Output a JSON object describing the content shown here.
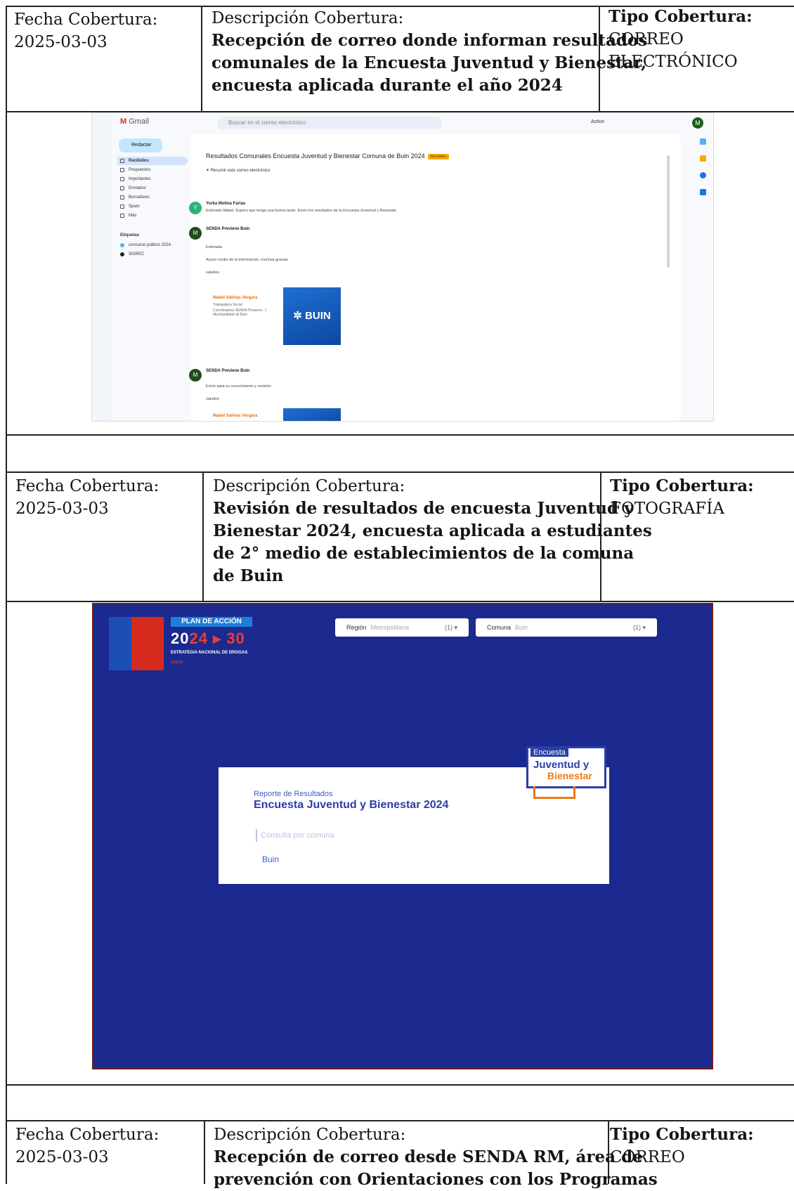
{
  "rows": [
    {
      "fecha_label": "Fecha Cobertura:",
      "fecha_value": "2025-03-03",
      "desc_label": "Descripción Cobertura:",
      "desc_lines": [
        "Recepción de correo donde informan resultados",
        "comunales de la Encuesta Juventud y Bienestar,",
        "encuesta aplicada durante el año 2024"
      ],
      "tipo_label": "Tipo Cobertura:",
      "tipo_lines": [
        "CORREO",
        "ELECTRÓNICO"
      ]
    },
    {
      "fecha_label": "Fecha Cobertura:",
      "fecha_value": "2025-03-03",
      "desc_label": "Descripción Cobertura:",
      "desc_lines": [
        "Revisión de resultados de encuesta Juventud y",
        "Bienestar 2024, encuesta aplicada a estudiantes",
        "de 2° medio de establecimientos de la comuna",
        "de Buin"
      ],
      "tipo_label": "Tipo Cobertura:",
      "tipo_lines": [
        "FOTOGRAFÍA"
      ]
    },
    {
      "fecha_label": "Fecha Cobertura:",
      "fecha_value": "2025-03-03",
      "desc_label": "Descripción Cobertura:",
      "desc_lines": [
        "Recepción de correo desde SENDA RM, área de",
        "prevención con Orientaciones con los Programas"
      ],
      "tipo_label": "Tipo Cobertura:",
      "tipo_lines": [
        "CORREO"
      ]
    }
  ],
  "gmail": {
    "app_name": "Gmail",
    "search_placeholder": "Buscar en el correo electrónico",
    "status": "Activo",
    "compose": "Redactar",
    "nav": [
      "Recibidos",
      "Pospuestos",
      "Importantes",
      "Enviados",
      "Borradores",
      "Spam",
      "Más"
    ],
    "labels_heading": "Etiquetas",
    "labels": [
      "concurso público 2024",
      "SISREC"
    ],
    "subject": "Resultados Comunales Encuesta Juventud y Bienestar Comuna de Buin 2024",
    "subject_badge": "Recibidos",
    "summary": "Resumir este correo electrónico",
    "msg1_sender": "Yorka Molina Farías",
    "msg1_body": "Estimado Mabel, Espero que tenga una buena tarde. Envío los resultados de la Encuesta Juventud y Bienestar.",
    "msg2_sender": "SENDA Previene Buin",
    "msg2_body": [
      "Estimada",
      "Acuso recibo de la información, muchas gracias",
      "saludos"
    ],
    "signature_name": "Mabel Salinas Vergara",
    "signature_lines": [
      "Trabajadora Social",
      "Coordinadora SENDA Previene - I. Municipalidad de Buin"
    ],
    "logo_text": "BUIN",
    "msg3_sender": "SENDA Previene Buin",
    "msg3_body": [
      "Envío para su conocimiento y revisión",
      "saludos"
    ],
    "signature2_name": "Mabel Salinas Vergara",
    "avatar_letter_v": "Y",
    "avatar_letter_m": "M"
  },
  "dashboard": {
    "plan": "PLAN DE ACCIÓN",
    "year_a": "20",
    "year_b": "24",
    "year_arrow": "▸",
    "year_c": "30",
    "strategy": "ESTRATEGIA NACIONAL DE DROGAS",
    "strategy_sub": "SENDA",
    "region_label": "Región",
    "region_value": "Metropolitana",
    "region_count": "(1) ▾",
    "comuna_label": "Comuna",
    "comuna_value": "Buin",
    "comuna_count": "(1) ▾",
    "kicker": "Reporte de Resultados",
    "title": "Encuesta Juventud y Bienestar 2024",
    "query": "Consulta por comuna",
    "result": "Buin",
    "logo_tag": "Encuesta",
    "logo_line1": "Juventud y",
    "logo_line2": "Bienestar"
  },
  "colors": {
    "dashboard_bg": "#1c2a8f",
    "accent_orange": "#ef7a1a",
    "gmail_red": "#d93025"
  }
}
